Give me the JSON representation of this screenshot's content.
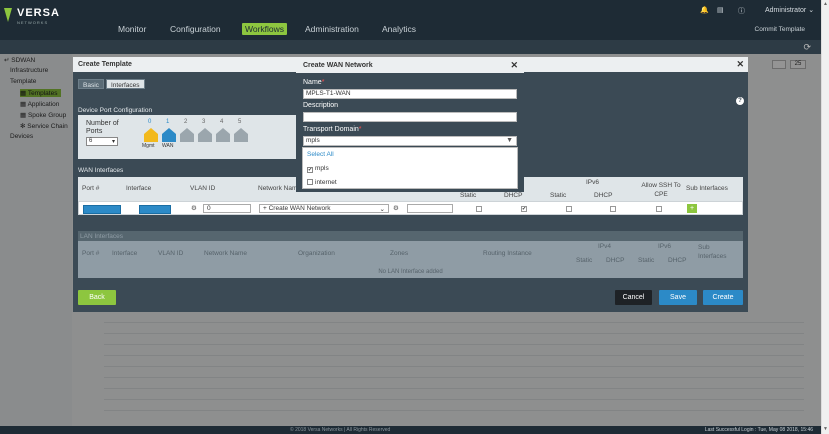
{
  "app": {
    "logo": "VERSA",
    "logo_sub": "NETWORKS",
    "nav": [
      "Monitor",
      "Configuration",
      "Workflows",
      "Administration",
      "Analytics"
    ],
    "active_nav": "Workflows",
    "user": "Administrator",
    "commit_label": "Commit Template",
    "brand_green": "#8dc63f",
    "brand_blue": "#2c8ac7"
  },
  "sidebar": {
    "items": [
      "SDWAN",
      "Infrastructure",
      "Template",
      "Templates",
      "Application",
      "Spoke Group",
      "Service Chain",
      "Devices"
    ]
  },
  "pager": {
    "page": "25"
  },
  "template_modal": {
    "title": "Create Template",
    "tabs": [
      "Basic",
      "Interfaces"
    ],
    "device_port_title": "Device Port Configuration",
    "num_ports_label": "Number of Ports",
    "num_ports_value": "6",
    "port_numbers": [
      "0",
      "1",
      "2",
      "3",
      "4",
      "5"
    ],
    "port_caps": [
      "Mgmt",
      "WAN"
    ],
    "wan_interfaces_title": "WAN Interfaces",
    "wan_cols": [
      "Port #",
      "Interface",
      "VLAN ID",
      "Network Name",
      "Static",
      "DHCP",
      "IPv6",
      "Static",
      "DHCP",
      "Allow SSH To CPE",
      "Sub Interfaces"
    ],
    "wan_row": {
      "vlan": "0",
      "network": "+ Create WAN Network",
      "dhcp4": "✔"
    },
    "lan_interfaces_title": "LAN Interfaces",
    "lan_cols": [
      "Port #",
      "Interface",
      "VLAN ID",
      "Network Name",
      "Organization",
      "Zones",
      "Routing Instance",
      "IPv4",
      "IPv6",
      "Sub Interfaces",
      "Static",
      "DHCP",
      "Static",
      "DHCP"
    ],
    "lan_empty": "No LAN Interface added",
    "buttons": {
      "back": "Back",
      "cancel": "Cancel",
      "save": "Save",
      "create": "Create"
    }
  },
  "wan_modal": {
    "title": "Create WAN Network",
    "name_label": "Name",
    "name_value": "MPLS-T1-WAN",
    "description_label": "Description",
    "description_value": "",
    "transport_label": "Transport Domain",
    "transport_value": "mpls",
    "options": [
      "Select All",
      "mpls",
      "internet"
    ]
  },
  "footer": {
    "copyright": "© 2018 Versa Networks | All Rights Reserved",
    "last_login": "Last Successful Login : Tue, May 08 2018, 15:46"
  }
}
